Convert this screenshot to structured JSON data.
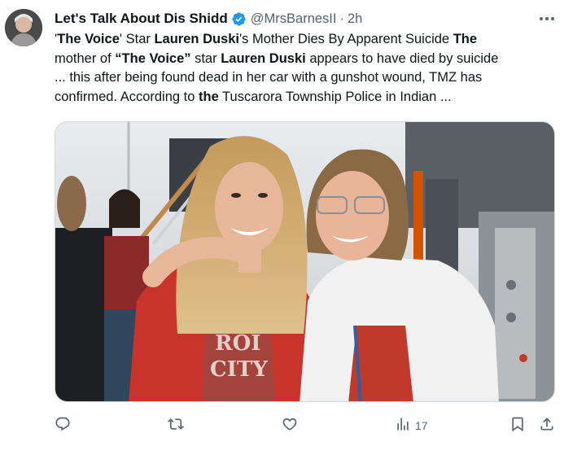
{
  "tweet": {
    "display_name": "Let's Talk About Dis Shidd",
    "handle": "@MrsBarnesII",
    "separator": "·",
    "time": "2h",
    "text": {
      "line1": [
        {
          "t": "'",
          "b": false
        },
        {
          "t": "The Voice",
          "b": true
        },
        {
          "t": "' Star ",
          "b": false
        },
        {
          "t": "Lauren Duski",
          "b": true
        },
        {
          "t": "'s Mother Dies By Apparent Suicide ",
          "b": false
        },
        {
          "t": "The",
          "b": true
        }
      ],
      "line2": [
        {
          "t": "mother of ",
          "b": false
        },
        {
          "t": "“The Voice”",
          "b": true
        },
        {
          "t": " star ",
          "b": false
        },
        {
          "t": "Lauren Duski",
          "b": true
        },
        {
          "t": " appears to have died by suicide",
          "b": false
        }
      ],
      "line3": "... this after being found dead in her car with a gunshot wound, TMZ has",
      "line4": [
        {
          "t": "confirmed. According to ",
          "b": false
        },
        {
          "t": "the",
          "b": true
        },
        {
          "t": " Tuscarora Township Police in Indian ...",
          "b": false
        }
      ]
    },
    "media": {
      "description_icon": "photo-two-women",
      "shirt_text_1": "ROI",
      "shirt_text_2": "CITY"
    },
    "actions": {
      "reply_icon": "reply-icon",
      "retweet_icon": "retweet-icon",
      "like_icon": "like-icon",
      "views_icon": "views-icon",
      "views_count": "17",
      "bookmark_icon": "bookmark-icon",
      "share_icon": "share-icon"
    }
  },
  "colors": {
    "text_primary": "#0f1419",
    "text_secondary": "#536471",
    "verified_blue": "#1d9bf0"
  }
}
